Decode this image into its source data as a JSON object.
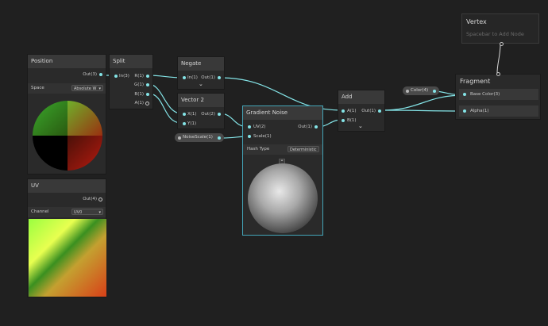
{
  "nodes": {
    "position": {
      "title": "Position",
      "out": "Out(3)",
      "space_label": "Space",
      "space_value": "Absolute W"
    },
    "split": {
      "title": "Split",
      "in": "In(3)",
      "outputs": [
        "R(1)",
        "G(1)",
        "B(1)",
        "A(1)"
      ]
    },
    "negate": {
      "title": "Negate",
      "in": "In(1)",
      "out": "Out(1)"
    },
    "vector2": {
      "title": "Vector 2",
      "in_x": "X(1)",
      "in_y": "Y(1)",
      "out": "Out(2)"
    },
    "noise_scale": {
      "label": "NoiseScale(1)"
    },
    "gradient_noise": {
      "title": "Gradient Noise",
      "in_uv": "UV(2)",
      "in_scale": "Scale(1)",
      "out": "Out(1)",
      "hash_label": "Hash Type",
      "hash_value": "Deterministic"
    },
    "add": {
      "title": "Add",
      "in_a": "A(1)",
      "in_b": "B(1)",
      "out": "Out(1)"
    },
    "color": {
      "label": "Color(4)"
    },
    "uv": {
      "title": "UV",
      "out": "Out(4)",
      "channel_label": "Channel",
      "channel_value": "UV0"
    },
    "vertex": {
      "title": "Vertex",
      "hint": "Spacebar to Add Node"
    },
    "fragment": {
      "title": "Fragment",
      "inputs": [
        "Base Color(3)",
        "Alpha(1)"
      ]
    }
  }
}
